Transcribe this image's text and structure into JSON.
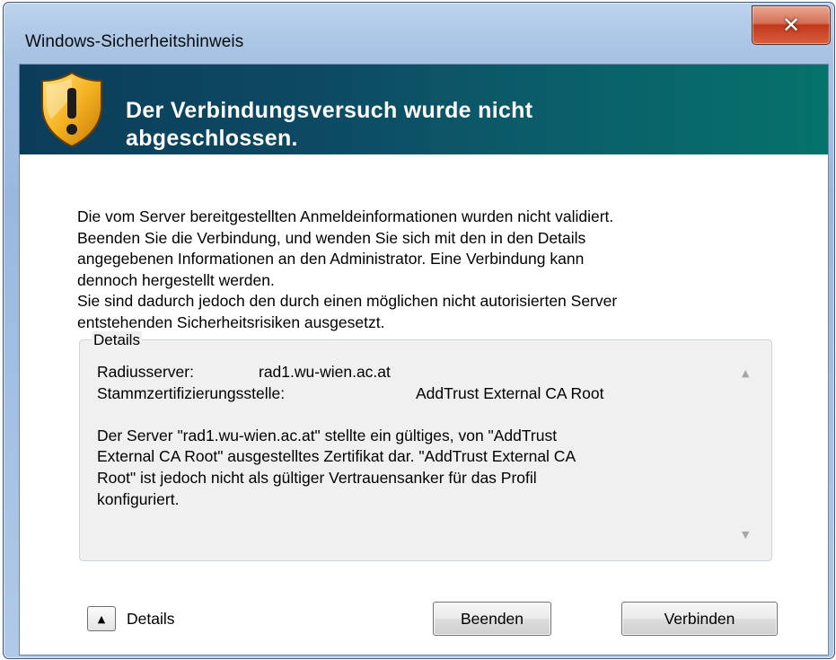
{
  "window": {
    "title": "Windows-Sicherheitshinweis",
    "close_label": "x"
  },
  "banner": {
    "title": "Der Verbindungsversuch wurde nicht\nabgeschlossen.",
    "icon": "warning-shield-icon"
  },
  "message": "Die vom Server bereitgestellten Anmeldeinformationen wurden nicht validiert.\nBeenden Sie die Verbindung, und wenden Sie sich mit den in den Details\nangegebenen Informationen an den Administrator. Eine Verbindung kann\ndennoch hergestellt werden.\nSie sind dadurch jedoch den durch einen möglichen nicht autorisierten Server\nentstehenden Sicherheitsrisiken ausgesetzt.",
  "details": {
    "legend": "Details",
    "rows": [
      {
        "key": "Radiusserver:",
        "value": "rad1.wu-wien.ac.at"
      },
      {
        "key": "Stammzertifizierungsstelle:",
        "value": "AddTrust External CA Root"
      }
    ],
    "paragraph": "Der Server \"rad1.wu-wien.ac.at\" stellte ein gültiges, von \"AddTrust\nExternal CA Root\" ausgestelltes Zertifikat dar. \"AddTrust External CA\nRoot\" ist jedoch nicht als gültiger Vertrauensanker für das Profil\nkonfiguriert."
  },
  "footer": {
    "toggle_label": "Details",
    "cancel_label": "Beenden",
    "connect_label": "Verbinden"
  },
  "colors": {
    "banner_start": "#0b3d59",
    "banner_end": "#05726b",
    "close_button": "#c2371a"
  }
}
